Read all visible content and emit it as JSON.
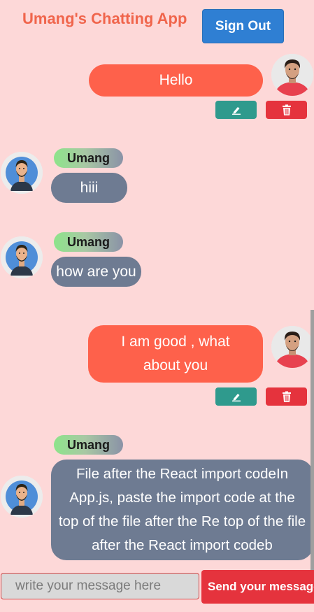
{
  "header": {
    "title": "Umang's Chatting App",
    "sign_out_label": "Sign Out"
  },
  "messages": [
    {
      "text": "Hello",
      "from": "self",
      "avatar": "user-avatar-self"
    },
    {
      "sender": "Umang",
      "text": "hiii",
      "from": "other",
      "avatar": "user-avatar-umang"
    },
    {
      "sender": "Umang",
      "text": "how are you",
      "from": "other",
      "avatar": "user-avatar-umang"
    },
    {
      "text": "I am good , what about you",
      "from": "self",
      "avatar": "user-avatar-self"
    },
    {
      "sender": "Umang",
      "text": "File after the React import codeIn App.js, paste the import code at the top of the file after the Re top of the file after the React import codeb",
      "from": "other",
      "avatar": "user-avatar-umang"
    }
  ],
  "actions": {
    "edit_icon": "pencil-icon",
    "delete_icon": "trash-icon"
  },
  "composer": {
    "placeholder": "write your message here",
    "send_label": "Send your message"
  },
  "colors": {
    "background": "#fdd8d8",
    "title": "#f0654c",
    "sign_out": "#2f7fd3",
    "own_bubble": "#fe614b",
    "other_bubble": "#6e7b92",
    "edit": "#2f9a8d",
    "delete": "#e5333d"
  }
}
